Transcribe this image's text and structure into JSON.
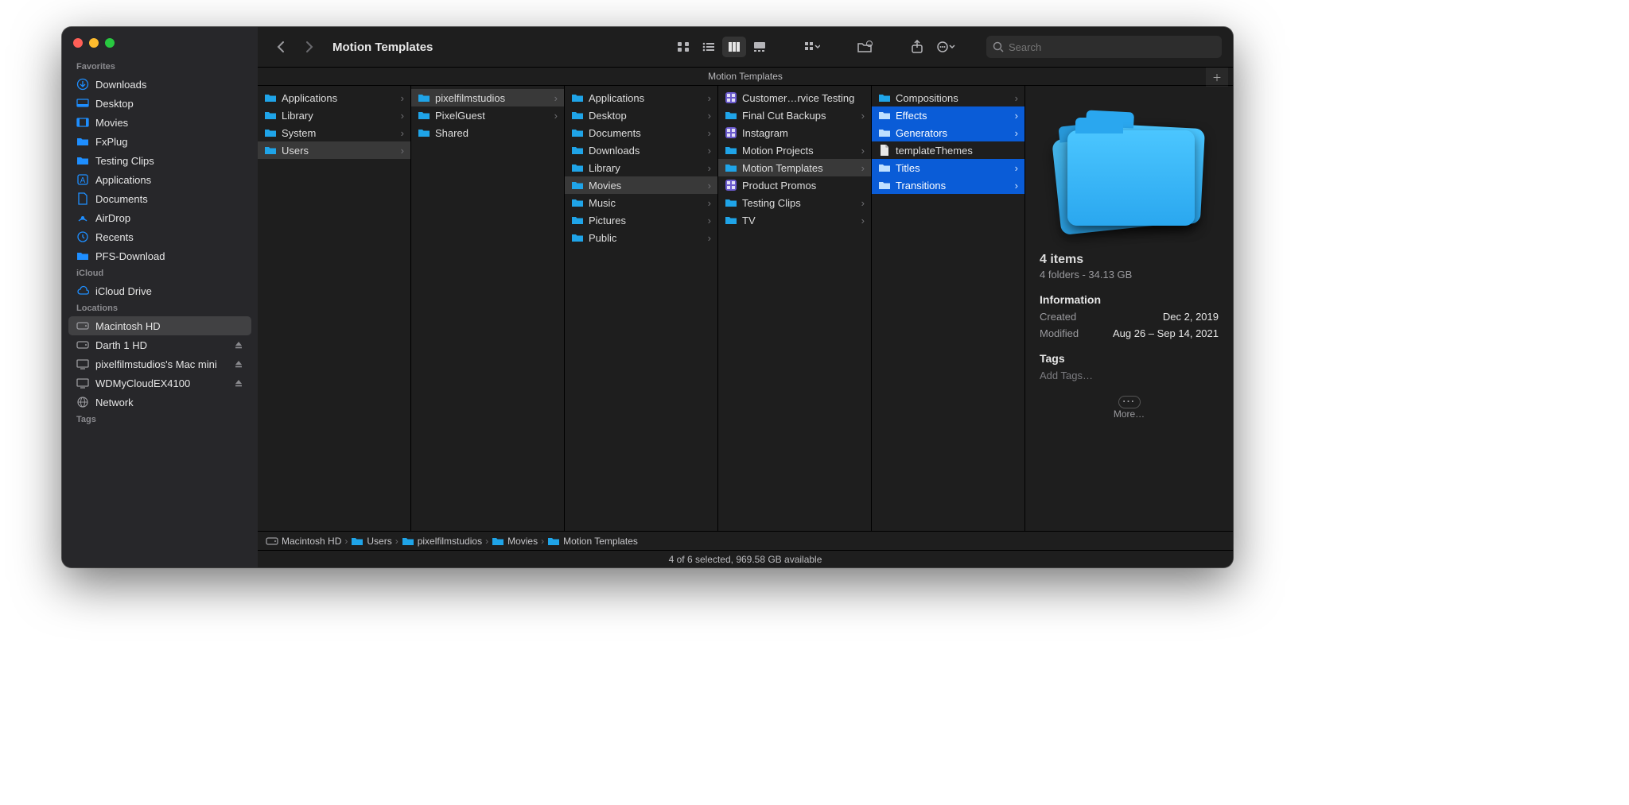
{
  "window": {
    "title": "Motion Templates",
    "subheader": "Motion Templates"
  },
  "search": {
    "placeholder": "Search"
  },
  "sidebar": {
    "sections": [
      {
        "label": "Favorites",
        "items": [
          {
            "label": "Downloads",
            "icon": "download"
          },
          {
            "label": "Desktop",
            "icon": "desktop"
          },
          {
            "label": "Movies",
            "icon": "movies"
          },
          {
            "label": "FxPlug",
            "icon": "folder"
          },
          {
            "label": "Testing Clips",
            "icon": "folder"
          },
          {
            "label": "Applications",
            "icon": "apps"
          },
          {
            "label": "Documents",
            "icon": "docs"
          },
          {
            "label": "AirDrop",
            "icon": "airdrop"
          },
          {
            "label": "Recents",
            "icon": "recents"
          },
          {
            "label": "PFS-Download",
            "icon": "folder"
          }
        ]
      },
      {
        "label": "iCloud",
        "items": [
          {
            "label": "iCloud Drive",
            "icon": "cloud"
          }
        ]
      },
      {
        "label": "Locations",
        "items": [
          {
            "label": "Macintosh HD",
            "icon": "disk",
            "selected": true
          },
          {
            "label": "Darth 1 HD",
            "icon": "disk",
            "eject": true
          },
          {
            "label": "pixelfilmstudios's Mac mini",
            "icon": "screen",
            "eject": true
          },
          {
            "label": "WDMyCloudEX4100",
            "icon": "screen",
            "eject": true
          },
          {
            "label": "Network",
            "icon": "globe"
          }
        ]
      },
      {
        "label": "Tags",
        "items": []
      }
    ]
  },
  "columns": [
    [
      {
        "label": "Applications",
        "icon": "folder",
        "chev": true
      },
      {
        "label": "Library",
        "icon": "folder",
        "chev": true
      },
      {
        "label": "System",
        "icon": "folder",
        "chev": true
      },
      {
        "label": "Users",
        "icon": "folder",
        "chev": true,
        "path": true
      }
    ],
    [
      {
        "label": "pixelfilmstudios",
        "icon": "folder",
        "chev": true,
        "path": true
      },
      {
        "label": "PixelGuest",
        "icon": "folder",
        "chev": true
      },
      {
        "label": "Shared",
        "icon": "folder"
      }
    ],
    [
      {
        "label": "Applications",
        "icon": "folder",
        "chev": true
      },
      {
        "label": "Desktop",
        "icon": "folder",
        "chev": true
      },
      {
        "label": "Documents",
        "icon": "folder",
        "chev": true
      },
      {
        "label": "Downloads",
        "icon": "folder",
        "chev": true
      },
      {
        "label": "Library",
        "icon": "folder",
        "chev": true
      },
      {
        "label": "Movies",
        "icon": "folder",
        "chev": true,
        "path": true
      },
      {
        "label": "Music",
        "icon": "folder",
        "chev": true
      },
      {
        "label": "Pictures",
        "icon": "folder",
        "chev": true
      },
      {
        "label": "Public",
        "icon": "folder",
        "chev": true
      }
    ],
    [
      {
        "label": "Customer…rvice Testing",
        "icon": "app"
      },
      {
        "label": "Final Cut Backups",
        "icon": "folder",
        "chev": true
      },
      {
        "label": "Instagram",
        "icon": "app"
      },
      {
        "label": "Motion Projects",
        "icon": "folder",
        "chev": true
      },
      {
        "label": "Motion Templates",
        "icon": "folder",
        "chev": true,
        "path": true
      },
      {
        "label": "Product Promos",
        "icon": "app"
      },
      {
        "label": "Testing Clips",
        "icon": "folder",
        "chev": true
      },
      {
        "label": "TV",
        "icon": "folder",
        "chev": true
      }
    ],
    [
      {
        "label": "Compositions",
        "icon": "folder",
        "chev": true
      },
      {
        "label": "Effects",
        "icon": "folder",
        "chev": true,
        "selected": true
      },
      {
        "label": "Generators",
        "icon": "folder",
        "chev": true,
        "selected": true
      },
      {
        "label": "templateThemes",
        "icon": "file"
      },
      {
        "label": "Titles",
        "icon": "folder",
        "chev": true,
        "selected": true
      },
      {
        "label": "Transitions",
        "icon": "folder",
        "chev": true,
        "selected": true
      }
    ]
  ],
  "preview": {
    "count_title": "4 items",
    "count_sub": "4 folders - 34.13 GB",
    "info_label": "Information",
    "created_k": "Created",
    "created_v": "Dec 2, 2019",
    "modified_k": "Modified",
    "modified_v": "Aug 26 – Sep 14, 2021",
    "tags_label": "Tags",
    "add_tags": "Add Tags…",
    "more": "More…"
  },
  "pathbar": [
    {
      "label": "Macintosh HD",
      "icon": "disk"
    },
    {
      "label": "Users",
      "icon": "folder"
    },
    {
      "label": "pixelfilmstudios",
      "icon": "folder"
    },
    {
      "label": "Movies",
      "icon": "folder"
    },
    {
      "label": "Motion Templates",
      "icon": "folder"
    }
  ],
  "status": "4 of 6 selected, 969.58 GB available"
}
